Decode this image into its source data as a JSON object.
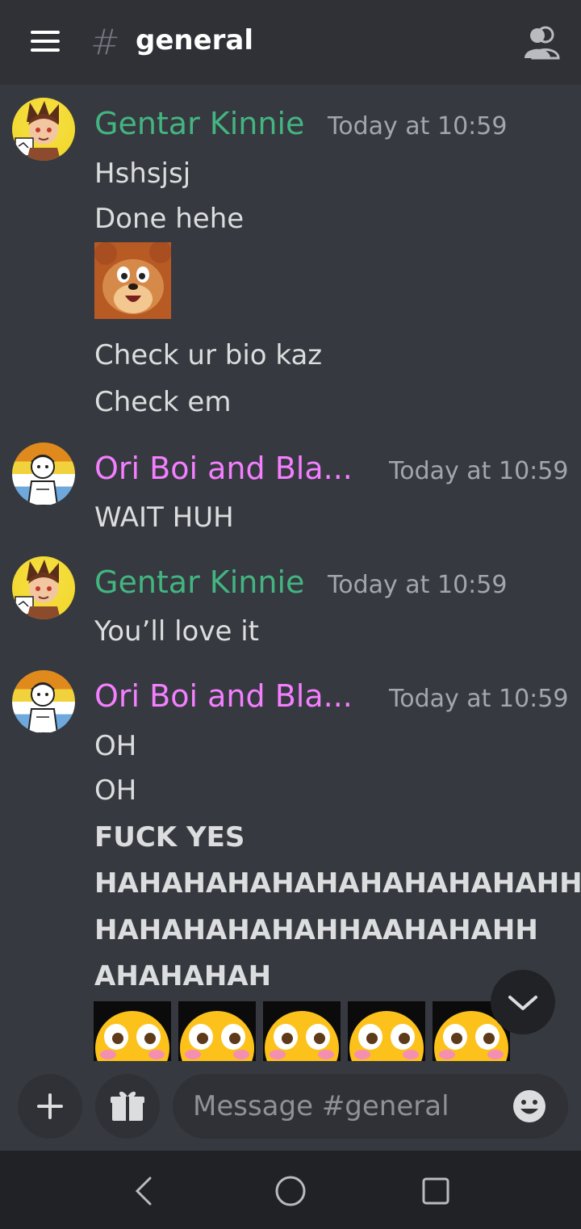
{
  "header": {
    "hash_symbol": "#",
    "channel_name": "general"
  },
  "messages": [
    {
      "author": "Gentar Kinnie",
      "timestamp": "Today at 10:59",
      "lines": [
        "Hshsjsj",
        "Done hehe"
      ],
      "sticker": "jerry-face",
      "lines_after": [
        "Check ur bio kaz",
        "Check em"
      ]
    },
    {
      "author": "Ori Boi and Bla...",
      "timestamp": "Today at 10:59",
      "lines": [
        "WAIT HUH"
      ]
    },
    {
      "author": "Gentar Kinnie",
      "timestamp": "Today at 10:59",
      "lines": [
        "You’ll love it"
      ]
    },
    {
      "author": "Ori Boi and Bla...",
      "timestamp": "Today at 10:59",
      "lines": [
        "OH",
        "OH",
        "FUCK YES",
        "HAHAHAHAHAHAHAHAHAHAHH",
        "HAHAHAHAHAHHAAHAHAHH",
        "AHAHAHAH"
      ],
      "emojis": [
        "flushed-emoji",
        "flushed-emoji",
        "flushed-emoji",
        "flushed-emoji",
        "flushed-emoji"
      ]
    }
  ],
  "composer": {
    "placeholder": "Message #general"
  },
  "colors": {
    "background": "#36393f",
    "header": "#2f3136",
    "gentar_name": "#43b581",
    "ori_name": "#f47fff",
    "timestamp": "#a3a6aa"
  },
  "icons": [
    "hamburger-menu-icon",
    "hash-icon",
    "members-icon",
    "chevron-down-icon",
    "plus-icon",
    "gift-icon",
    "emoji-icon",
    "back-icon",
    "home-icon",
    "recents-icon"
  ]
}
